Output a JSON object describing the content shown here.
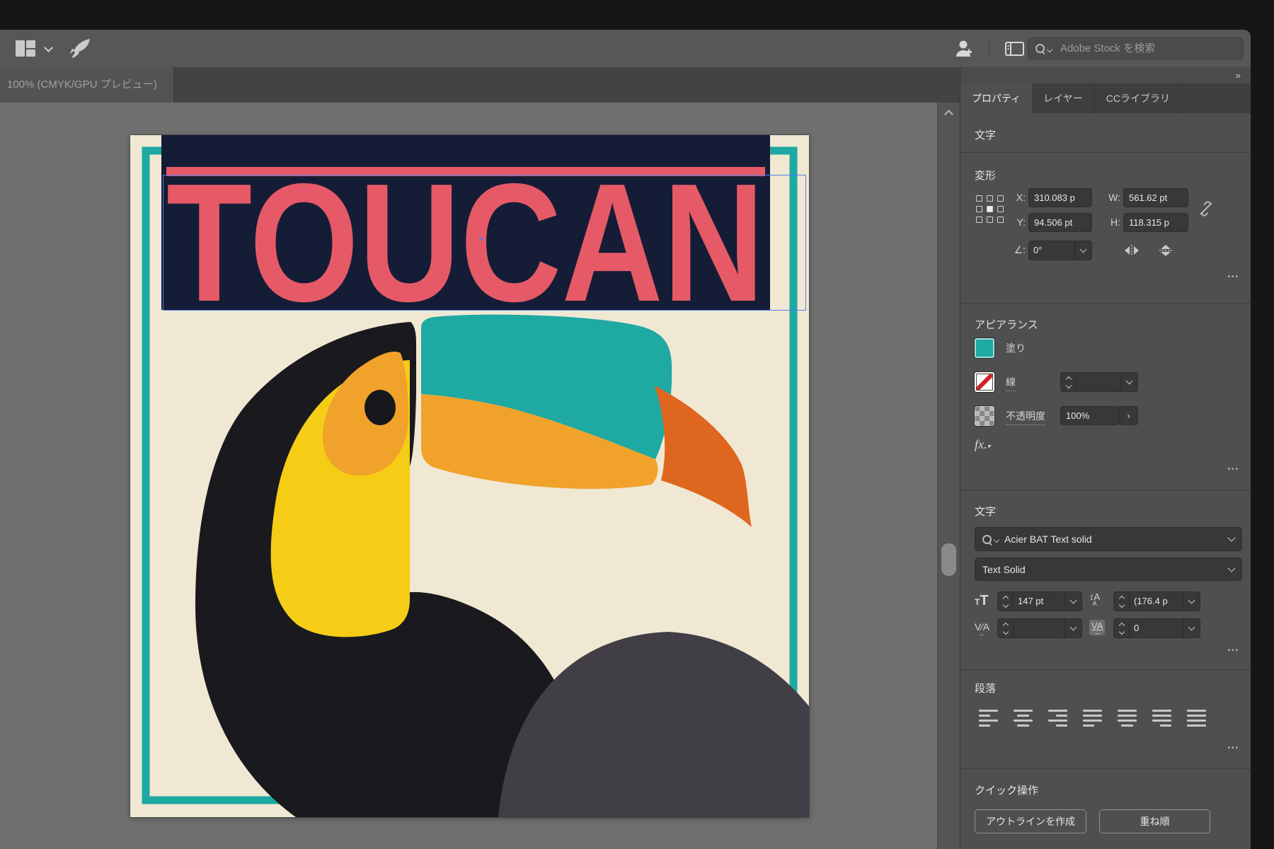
{
  "appbar": {
    "search_placeholder": "Adobe Stock を検索"
  },
  "tabbar": {
    "document_tab": "100% (CMYK/GPU プレビュー)",
    "expand_icon": "»"
  },
  "panel": {
    "tabs": {
      "properties": "プロパティ",
      "layers": "レイヤー",
      "libraries": "CCライブラリ"
    },
    "selection_label": "文字",
    "transform": {
      "title": "変形",
      "x_label": "X:",
      "x_value": "310.083 p",
      "y_label": "Y:",
      "y_value": "94.506 pt",
      "w_label": "W:",
      "w_value": "561.62 pt",
      "h_label": "H:",
      "h_value": "118.315 p",
      "angle_label": "∠:",
      "angle_value": "0°",
      "more": "•••"
    },
    "appearance": {
      "title": "アピアランス",
      "fill_label": "塗り",
      "stroke_label": "線",
      "stroke_value": "",
      "opacity_label": "不透明度",
      "opacity_value": "100%",
      "opacity_expand": "›",
      "fx_label": "fx.",
      "more": "•••"
    },
    "character": {
      "title": "文字",
      "font_name": "Acier BAT Text solid",
      "font_style": "Text Solid",
      "size_value": "147 pt",
      "leading_value": "(176.4 p",
      "kerning_value": "",
      "tracking_value": "0",
      "more": "•••"
    },
    "paragraph": {
      "title": "段落",
      "more": "•••"
    },
    "quick": {
      "title": "クイック操作",
      "create_outline": "アウトラインを作成",
      "arrange": "重ね順"
    }
  },
  "artwork": {
    "title": "TOUCAN",
    "colors": {
      "cream": "#f0e8d3",
      "frame_teal": "#1ea9a2",
      "navy": "#151d36",
      "red": "#e65a67",
      "yellow": "#f5cd17",
      "face_orange": "#f0a22b",
      "beak_teal": "#1ea9a2",
      "tip_orange": "#df661e",
      "black": "#1a191e",
      "eye_black": "#17161b",
      "gray": "#413f45",
      "selection_blue": "#4e7de9"
    }
  }
}
